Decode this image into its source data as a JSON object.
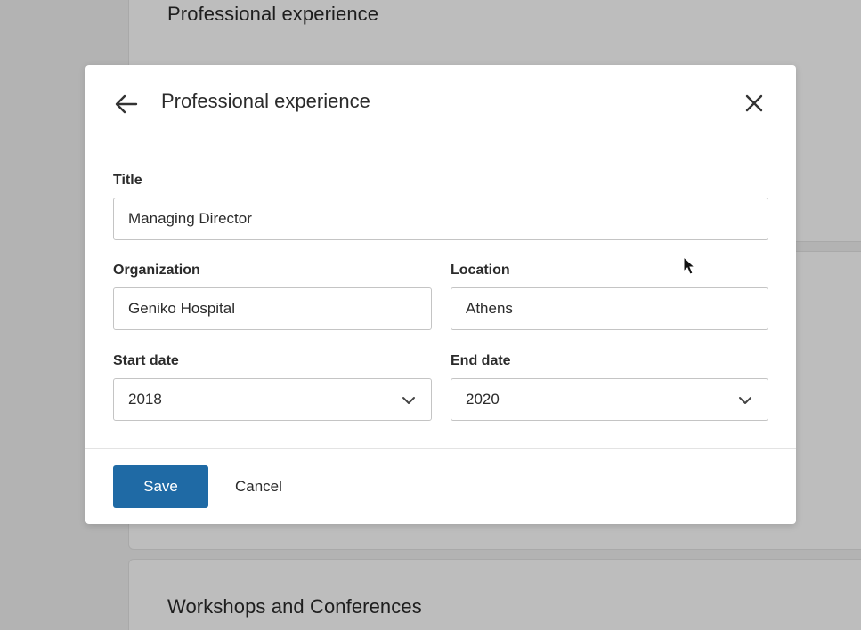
{
  "background": {
    "section_top_heading": "Professional experience",
    "section_bottom_heading": "Workshops and Conferences"
  },
  "modal": {
    "title": "Professional experience",
    "back_icon": "arrow-left-icon",
    "close_icon": "close-icon",
    "fields": {
      "title": {
        "label": "Title",
        "value": "Managing Director"
      },
      "organization": {
        "label": "Organization",
        "value": "Geniko Hospital"
      },
      "location": {
        "label": "Location",
        "value": "Athens"
      },
      "start_date": {
        "label": "Start date",
        "value": "2018"
      },
      "end_date": {
        "label": "End date",
        "value": "2020"
      }
    },
    "actions": {
      "save_label": "Save",
      "cancel_label": "Cancel"
    }
  },
  "colors": {
    "overlay": "#b3b3b3",
    "primary": "#1f6aa5",
    "surface": "#ffffff",
    "border": "#c4c4c4"
  }
}
